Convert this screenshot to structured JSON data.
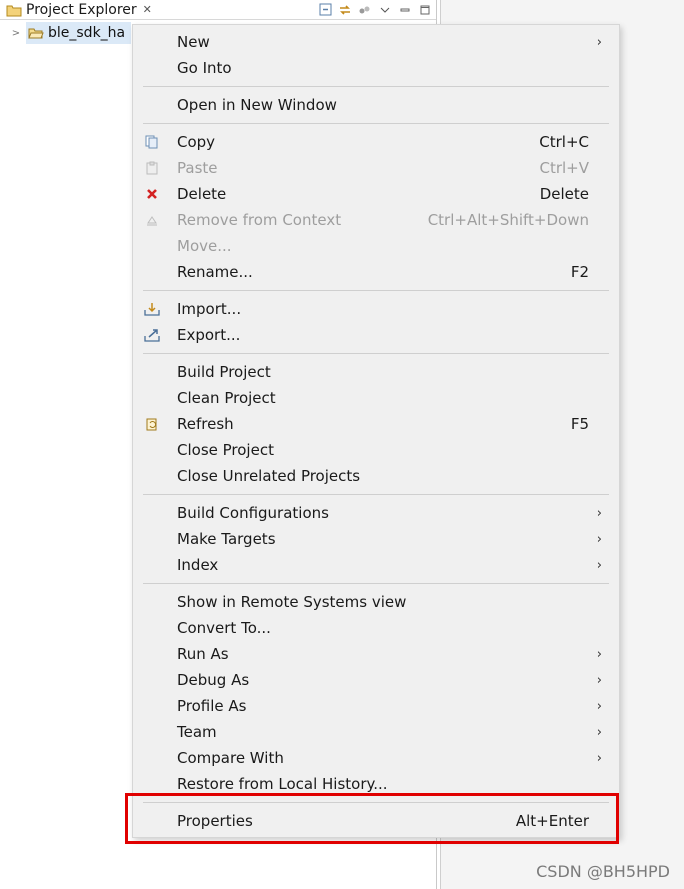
{
  "panel": {
    "title": "Project Explorer",
    "close_glyph": "✕",
    "toolbar_icons": [
      "collapse-all-icon",
      "link-editor-icon",
      "filter-icon",
      "view-menu-icon",
      "minimize-icon",
      "maximize-icon"
    ],
    "tree": {
      "expander": ">",
      "project_label": "ble_sdk_ha"
    }
  },
  "menu": {
    "new": {
      "label": "New"
    },
    "go_into": {
      "label": "Go Into"
    },
    "open_new_window": {
      "label": "Open in New Window"
    },
    "copy": {
      "label": "Copy",
      "shortcut": "Ctrl+C"
    },
    "paste": {
      "label": "Paste",
      "shortcut": "Ctrl+V"
    },
    "delete": {
      "label": "Delete",
      "shortcut": "Delete"
    },
    "remove_context": {
      "label": "Remove from Context",
      "shortcut": "Ctrl+Alt+Shift+Down"
    },
    "move": {
      "label": "Move..."
    },
    "rename": {
      "label": "Rename...",
      "shortcut": "F2"
    },
    "import": {
      "label": "Import..."
    },
    "export": {
      "label": "Export..."
    },
    "build_project": {
      "label": "Build Project"
    },
    "clean_project": {
      "label": "Clean Project"
    },
    "refresh": {
      "label": "Refresh",
      "shortcut": "F5"
    },
    "close_project": {
      "label": "Close Project"
    },
    "close_unrelated": {
      "label": "Close Unrelated Projects"
    },
    "build_configurations": {
      "label": "Build Configurations"
    },
    "make_targets": {
      "label": "Make Targets"
    },
    "index": {
      "label": "Index"
    },
    "show_remote": {
      "label": "Show in Remote Systems view"
    },
    "convert_to": {
      "label": "Convert To..."
    },
    "run_as": {
      "label": "Run As"
    },
    "debug_as": {
      "label": "Debug As"
    },
    "profile_as": {
      "label": "Profile As"
    },
    "team": {
      "label": "Team"
    },
    "compare_with": {
      "label": "Compare With"
    },
    "restore_history": {
      "label": "Restore from Local History..."
    },
    "properties": {
      "label": "Properties",
      "shortcut": "Alt+Enter"
    },
    "submenu_arrow": "›"
  },
  "colors": {
    "highlight_box": "#e00000",
    "selected_item_bg": "#dbe9f7",
    "delete_icon": "#d32222"
  },
  "watermark": "CSDN @BH5HPD"
}
